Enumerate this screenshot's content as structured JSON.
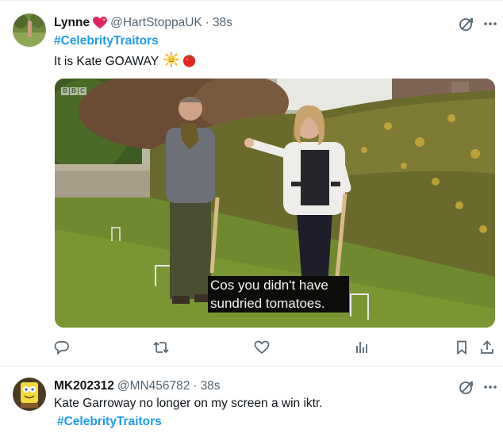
{
  "tweet1": {
    "display_name": "Lynne",
    "heart_emoji": "❤️",
    "handle": "@HartStoppaUK",
    "separator": "·",
    "time": "38s",
    "hashtag": "#CelebrityTraitors",
    "text": "It is Kate GOAWAY",
    "emojis": [
      "🌞",
      "🍅"
    ],
    "subtitle_line1": "Cos you didn't have",
    "subtitle_line2": "sundried tomatoes.",
    "broadcaster_mark": [
      "B",
      "B",
      "C"
    ]
  },
  "tweet2": {
    "display_name": "MK202312",
    "handle": "@MN456782",
    "separator": "·",
    "time": "38s",
    "text": "Kate Garroway no longer on my screen a win iktr.",
    "hashtag": "#CelebrityTraitors"
  },
  "icons": {
    "grok": "grok-icon",
    "more": "more-icon",
    "reply": "reply-icon",
    "retweet": "retweet-icon",
    "like": "like-icon",
    "views": "views-icon",
    "bookmark": "bookmark-icon",
    "share": "share-icon"
  },
  "colors": {
    "hashtag": "#1d9bf0",
    "secondary_text": "#536471",
    "icon": "#536471",
    "heart": "#e0245e"
  }
}
